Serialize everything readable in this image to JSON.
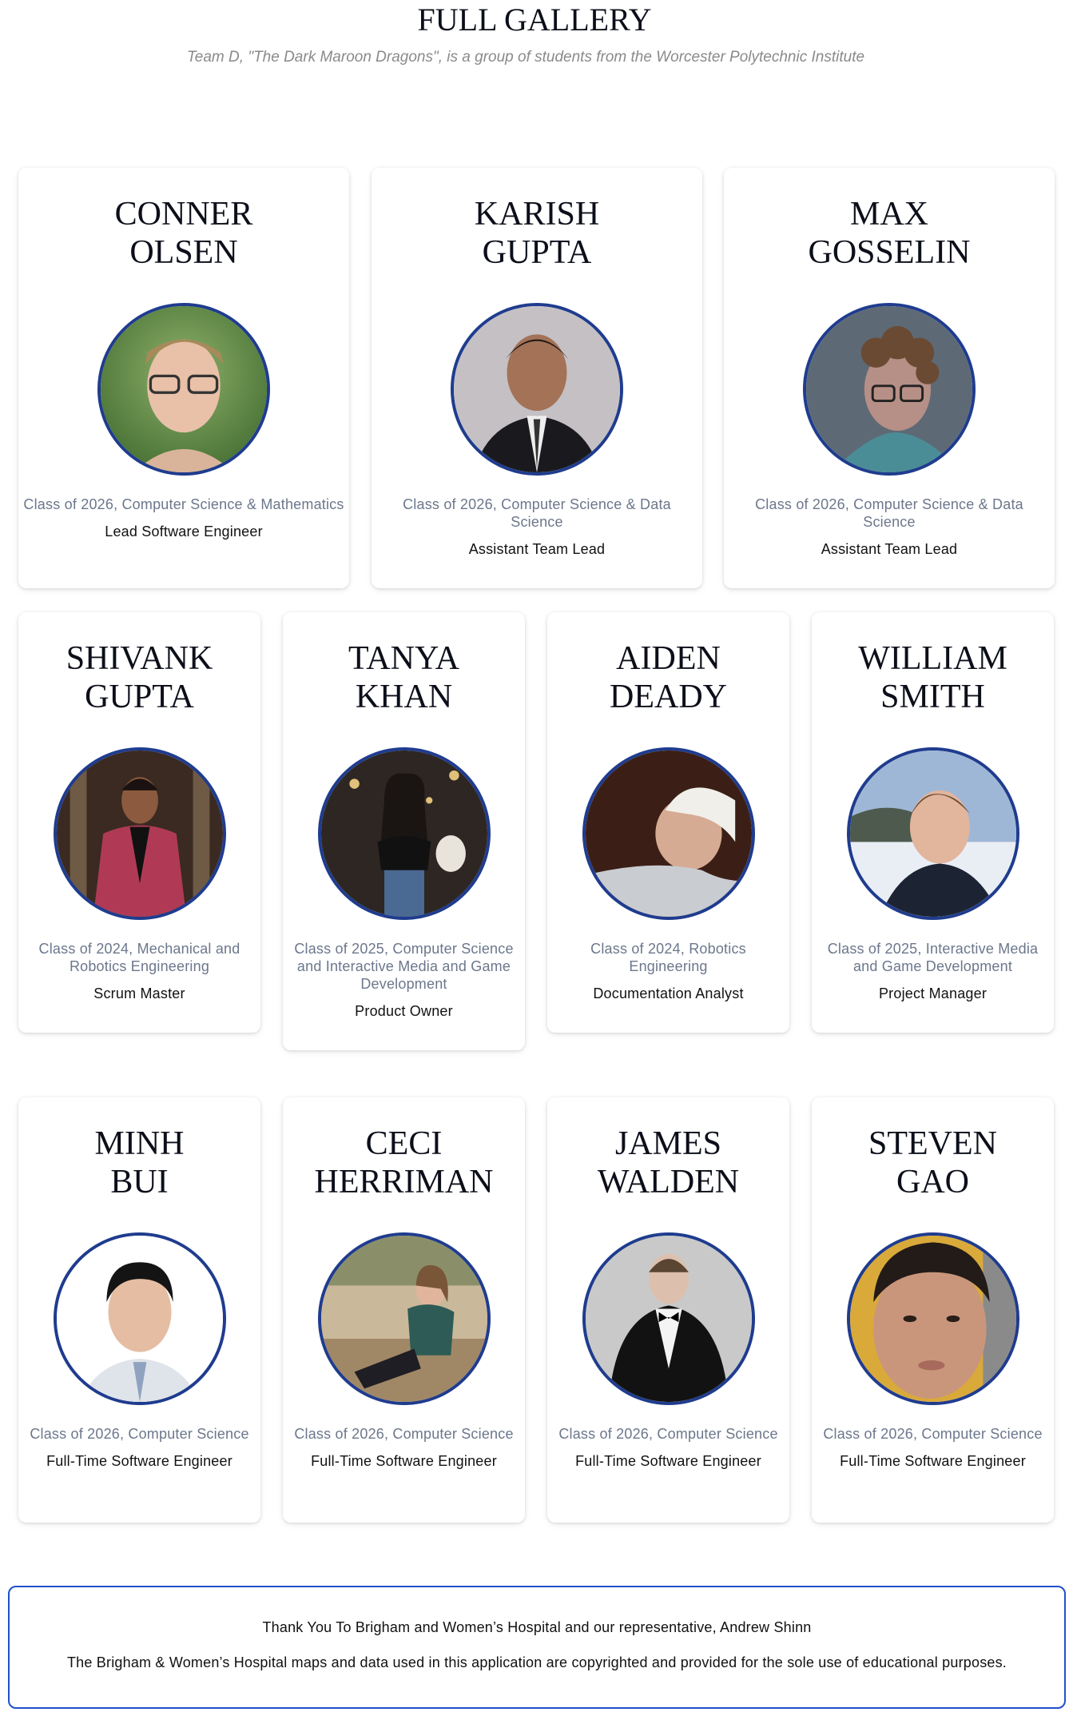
{
  "page": {
    "title": "FULL GALLERY",
    "subtitle": "Team D, \"The Dark Maroon Dragons\", is a group of students from the Worcester Polytechnic Institute"
  },
  "members": [
    {
      "name": "CONNER\nOLSEN",
      "class": "Class of 2026, Computer Science & Mathematics",
      "role": "Lead Software Engineer"
    },
    {
      "name": "KARISH\nGUPTA",
      "class": "Class of 2026, Computer Science & Data Science",
      "role": "Assistant Team Lead"
    },
    {
      "name": "MAX\nGOSSELIN",
      "class": "Class of 2026, Computer Science & Data Science",
      "role": "Assistant Team Lead"
    },
    {
      "name": "SHIVANK\nGUPTA",
      "class": "Class of 2024, Mechanical and Robotics Engineering",
      "role": "Scrum Master"
    },
    {
      "name": "TANYA\nKHAN",
      "class": "Class of 2025, Computer Science and Interactive Media and Game Development",
      "role": "Product Owner"
    },
    {
      "name": "AIDEN\nDEADY",
      "class": "Class of 2024, Robotics Engineering",
      "role": "Documentation Analyst"
    },
    {
      "name": "WILLIAM\nSMITH",
      "class": "Class of 2025, Interactive Media and Game Development",
      "role": "Project Manager"
    },
    {
      "name": "MINH\nBUI",
      "class": "Class of 2026, Computer Science",
      "role": "Full-Time Software Engineer"
    },
    {
      "name": "CECI\nHERRIMAN",
      "class": "Class of 2026, Computer Science",
      "role": "Full-Time Software Engineer"
    },
    {
      "name": "JAMES\nWALDEN",
      "class": "Class of 2026, Computer Science",
      "role": "Full-Time Software Engineer"
    },
    {
      "name": "STEVEN\nGAO",
      "class": "Class of 2026, Computer Science",
      "role": "Full-Time Software Engineer"
    }
  ],
  "footer": {
    "thanks": "Thank You To Brigham and Women’s Hospital and our representative, Andrew Shinn",
    "disclaimer": "The Brigham & Women’s Hospital maps and data used in this application are copyrighted and provided for the sole use of educational purposes."
  },
  "colors": {
    "avatar_border": "#1f3c8e",
    "footer_border": "#1f51c9",
    "class_text": "#6c778c"
  }
}
